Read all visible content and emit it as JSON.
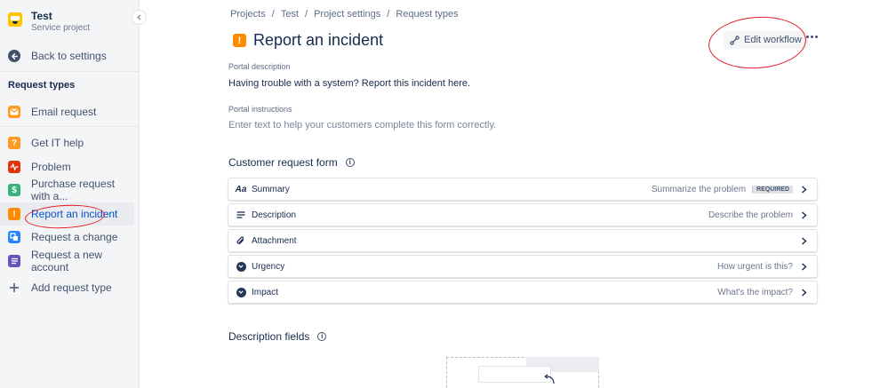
{
  "sidebar": {
    "project_name": "Test",
    "project_type": "Service project",
    "back_label": "Back to settings",
    "section_heading": "Request types",
    "items": [
      {
        "label": "Email request",
        "icon": "envelope-icon",
        "color": "#ff991f"
      },
      {
        "label": "Get IT help",
        "icon": "question-icon",
        "color": "#ff991f"
      },
      {
        "label": "Problem",
        "icon": "pulse-icon",
        "color": "#de350b"
      },
      {
        "label": "Purchase request with a...",
        "icon": "dollar-icon",
        "color": "#36b37e"
      },
      {
        "label": "Report an incident",
        "icon": "exclamation-icon",
        "color": "#ff8b00"
      },
      {
        "label": "Request a change",
        "icon": "change-icon",
        "color": "#2684ff"
      },
      {
        "label": "Request a new account",
        "icon": "account-list-icon",
        "color": "#6554c0"
      }
    ],
    "add_label": "Add request type"
  },
  "breadcrumb": [
    "Projects",
    "Test",
    "Project settings",
    "Request types"
  ],
  "breadcrumb_separator": "/",
  "page": {
    "title": "Report an incident",
    "edit_workflow_label": "Edit workflow",
    "portal_description_label": "Portal description",
    "portal_description_value": "Having trouble with a system? Report this incident here.",
    "portal_instructions_label": "Portal instructions",
    "portal_instructions_placeholder": "Enter text to help your customers complete this form correctly."
  },
  "customer_request_form": {
    "title": "Customer request form",
    "fields": [
      {
        "label": "Summary",
        "hint": "Summarize the problem",
        "badge": "REQUIRED",
        "icon": "text-format-icon"
      },
      {
        "label": "Description",
        "hint": "Describe the problem",
        "badge": "",
        "icon": "lines-icon"
      },
      {
        "label": "Attachment",
        "hint": "",
        "badge": "",
        "icon": "paperclip-icon"
      },
      {
        "label": "Urgency",
        "hint": "How urgent is this?",
        "badge": "",
        "icon": "dropdown-icon"
      },
      {
        "label": "Impact",
        "hint": "What's the impact?",
        "badge": "",
        "icon": "dropdown-icon"
      }
    ]
  },
  "description_fields": {
    "title": "Description fields"
  },
  "info_glyph": "i",
  "title_icon_glyph": "!",
  "text_format_glyph": "Aa",
  "colors": {
    "accent": "#0052cc",
    "annotation_red": "#e01b24",
    "incident_orange": "#ff8b00"
  }
}
